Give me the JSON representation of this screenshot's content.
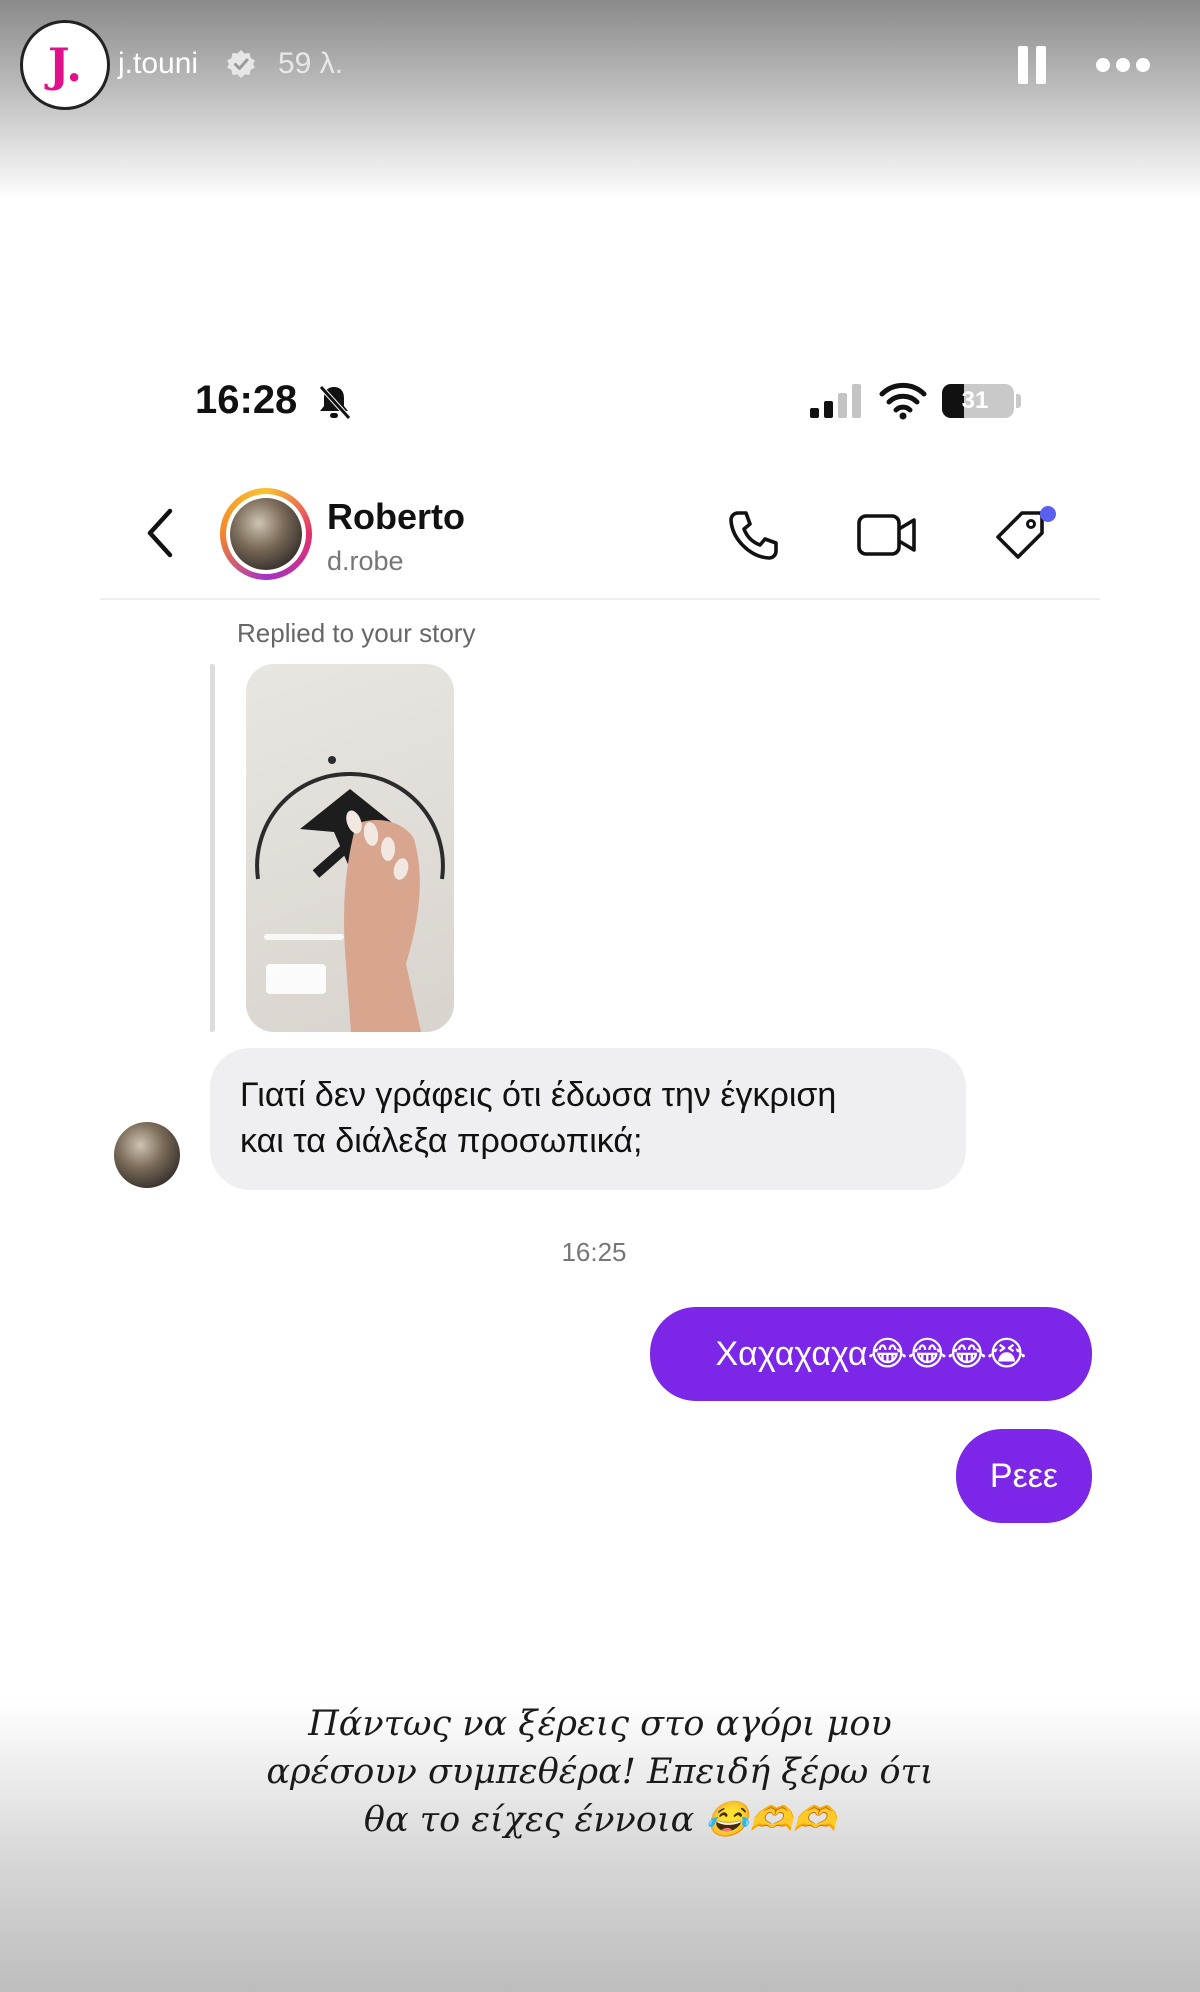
{
  "story": {
    "avatar_letter": "J.",
    "username": "j.touni",
    "time_ago": "59 λ.",
    "pause_icon": "pause-icon",
    "more_icon": "more-icon"
  },
  "status_bar": {
    "time": "16:28",
    "battery": "31",
    "icons": [
      "bell-slash-icon",
      "signal-icon",
      "wifi-icon",
      "battery-icon"
    ]
  },
  "chat_header": {
    "name": "Roberto",
    "handle": "d.robe",
    "icons": [
      "back-icon",
      "phone-icon",
      "video-icon",
      "tag-icon"
    ],
    "accent": "#5b5ff0"
  },
  "messages": {
    "replied_label": "Replied to your story",
    "incoming": [
      "Γιατί δεν γράφεις ότι έδωσα την έγκριση",
      "και τα διάλεξα προσωπικά;"
    ],
    "timestamp": "16:25",
    "outgoing": [
      "Χαχαχαχα😂😂😂😭",
      "Ρεεε"
    ],
    "bubble_color": "#7c27e8"
  },
  "caption": {
    "lines": [
      "Πάντως να ξέρεις στο αγόρι μου",
      "αρέσουν συμπεθέρα! Επειδή ξέρω ότι",
      "θα το είχες έννοια 😂🫶🫶"
    ]
  }
}
